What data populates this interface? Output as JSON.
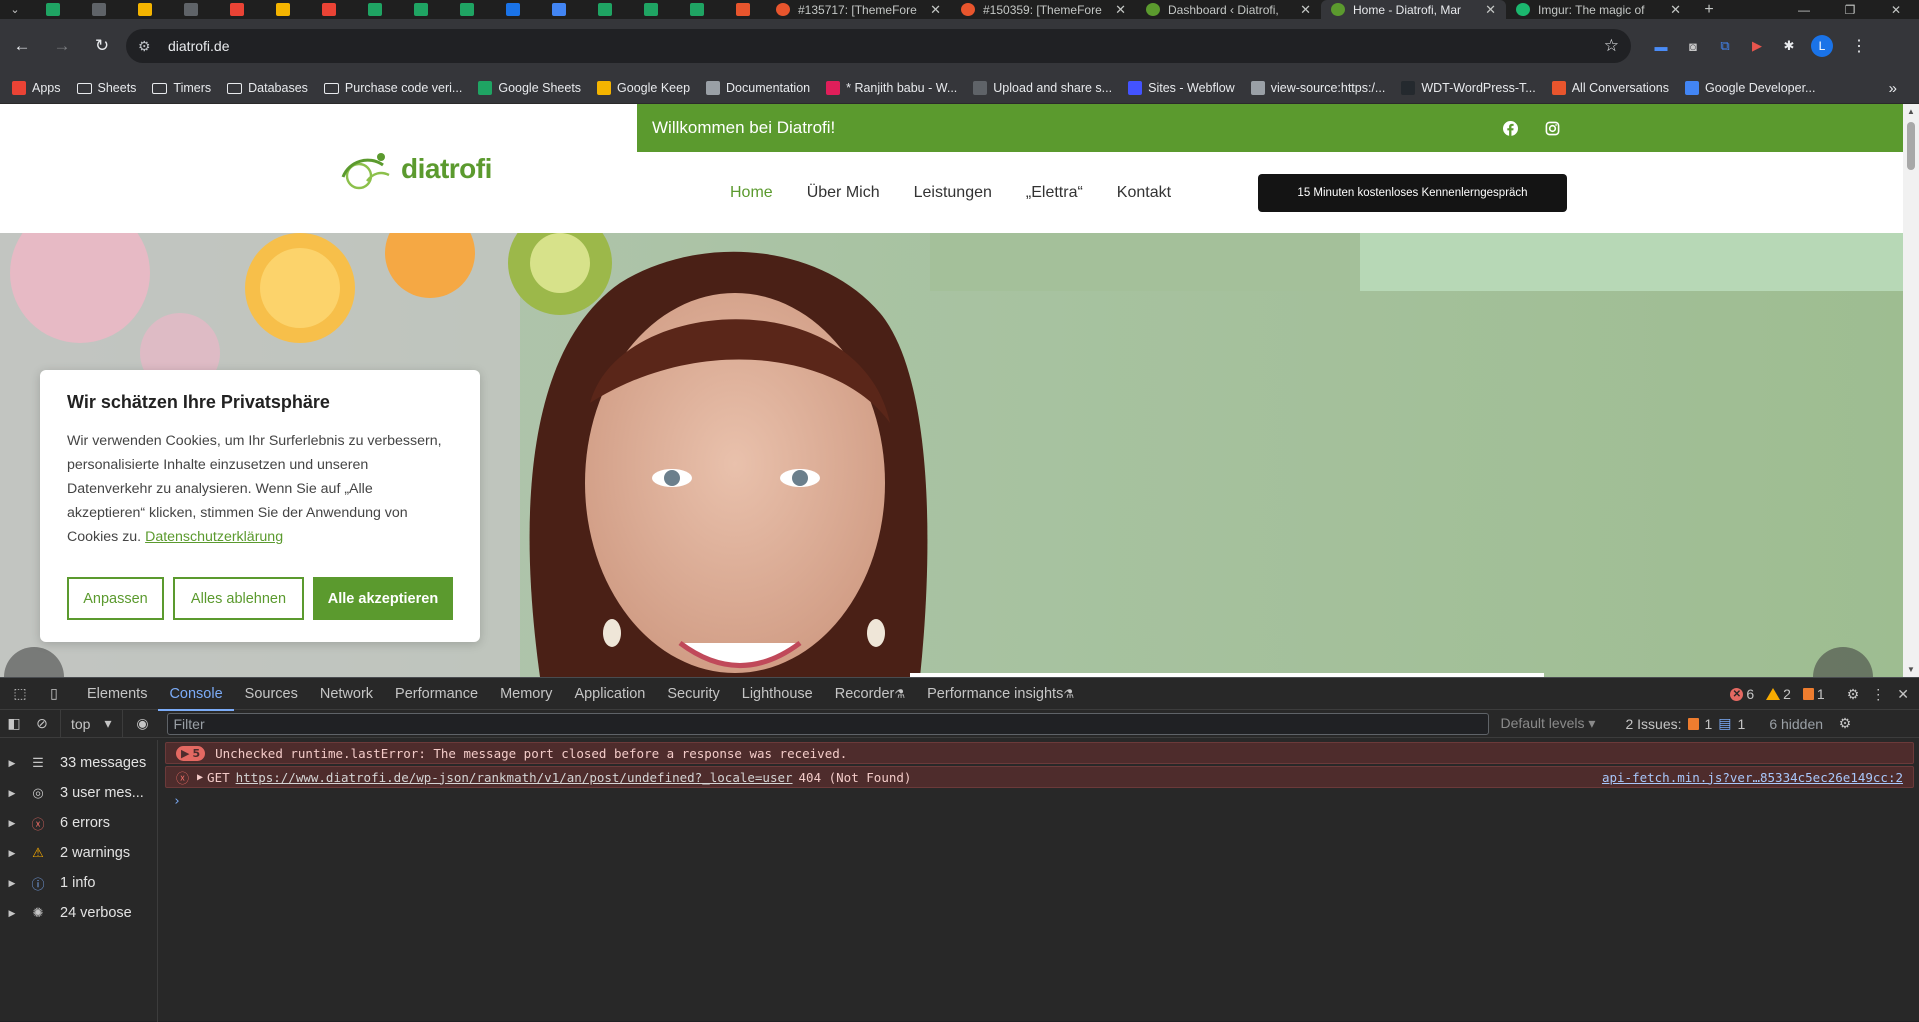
{
  "browser": {
    "tabs": [
      {
        "title": "#135717: [ThemeFore",
        "favicon_color": "#e8552d"
      },
      {
        "title": "#150359: [ThemeFore",
        "favicon_color": "#e8552d"
      },
      {
        "title": "Dashboard ‹ Diatrofi,",
        "favicon_color": "#5b9a2e"
      },
      {
        "title": "Home - Diatrofi, Mar",
        "favicon_color": "#5b9a2e",
        "active": true
      },
      {
        "title": "Imgur: The magic of",
        "favicon_color": "#1bb76e"
      }
    ],
    "pinned_tab_colors": [
      "#1fa463",
      "#5f6368",
      "#f4b400",
      "#5f6368",
      "#ea4335",
      "#f4b400",
      "#ea4335",
      "#1fa463",
      "#1fa463",
      "#1fa463",
      "#1a73e8",
      "#4285f4",
      "#1fa463",
      "#1fa463",
      "#1fa463",
      "#e8552d"
    ],
    "address": "diatrofi.de",
    "profile_initial": "L",
    "bookmarks": [
      {
        "label": "Apps",
        "icon": "apps-grid-icon",
        "color": "#ea4335"
      },
      {
        "label": "Sheets",
        "icon": "folder-icon"
      },
      {
        "label": "Timers",
        "icon": "folder-icon"
      },
      {
        "label": "Databases",
        "icon": "folder-icon"
      },
      {
        "label": "Purchase code veri...",
        "icon": "folder-icon"
      },
      {
        "label": "Google Sheets",
        "icon": "sheets-icon",
        "color": "#1fa463"
      },
      {
        "label": "Google Keep",
        "icon": "keep-icon",
        "color": "#f4b400"
      },
      {
        "label": "Documentation",
        "icon": "globe-icon",
        "color": "#9aa0a6"
      },
      {
        "label": "* Ranjith babu - W...",
        "icon": "slack-icon",
        "color": "#e01e5a"
      },
      {
        "label": "Upload and share s...",
        "icon": "sb-icon",
        "color": "#5f6368"
      },
      {
        "label": "Sites - Webflow",
        "icon": "webflow-icon",
        "color": "#4353ff"
      },
      {
        "label": "view-source:https:/...",
        "icon": "globe-icon",
        "color": "#9aa0a6"
      },
      {
        "label": "WDT-WordPress-T...",
        "icon": "github-icon",
        "color": "#24292e"
      },
      {
        "label": "All Conversations",
        "icon": "conversation-icon",
        "color": "#e8552d"
      },
      {
        "label": "Google Developer...",
        "icon": "google-icon",
        "color": "#4285f4"
      }
    ]
  },
  "site": {
    "logo_text": "diatrofi",
    "brand_color": "#5b9a2e",
    "topbar_text": "Willkommen bei Diatrofi!",
    "nav": [
      {
        "label": "Home",
        "active": true
      },
      {
        "label": "Über Mich"
      },
      {
        "label": "Leistungen"
      },
      {
        "label": "„Elettra“"
      },
      {
        "label": "Kontakt"
      }
    ],
    "cta_label": "15 Minuten kostenloses Kennenlerngespräch"
  },
  "cookie": {
    "title": "Wir schätzen Ihre Privatsphäre",
    "body": "Wir verwenden Cookies, um Ihr Surferlebnis zu verbessern, personalisierte Inhalte einzusetzen und unseren Datenverkehr zu analysieren. Wenn Sie auf „Alle akzeptieren“ klicken, stimmen Sie der Anwendung von Cookies zu.",
    "link": "Datenschutzerklärung",
    "buttons": {
      "customize": "Anpassen",
      "reject": "Alles ablehnen",
      "accept": "Alle akzeptieren"
    }
  },
  "devtools": {
    "tabs": [
      "Elements",
      "Console",
      "Sources",
      "Network",
      "Performance",
      "Memory",
      "Application",
      "Security",
      "Lighthouse",
      "Recorder",
      "Performance insights"
    ],
    "active_tab": "Console",
    "counts": {
      "errors": "6",
      "warnings": "2",
      "issues_badge": "1"
    },
    "context": "top",
    "filter_placeholder": "Filter",
    "levels": "Default levels",
    "issues_label": "2 Issues:",
    "issues_counts": {
      "warn": "1",
      "info": "1"
    },
    "hidden": "6 hidden",
    "sidebar": [
      {
        "label": "33 messages",
        "icon": "list-icon"
      },
      {
        "label": "3 user mes...",
        "icon": "user-icon"
      },
      {
        "label": "6 errors",
        "icon": "error-icon"
      },
      {
        "label": "2 warnings",
        "icon": "warning-icon"
      },
      {
        "label": "1 info",
        "icon": "info-icon"
      },
      {
        "label": "24 verbose",
        "icon": "bug-icon"
      }
    ],
    "messages": [
      {
        "count": "5",
        "text": "Unchecked runtime.lastError: The message port closed before a response was received."
      },
      {
        "method": "GET",
        "url": "https://www.diatrofi.de/wp-json/rankmath/v1/an/post/undefined?_locale=user",
        "status": "404 (Not Found)",
        "source": "api-fetch.min.js?ver…85334c5ec26e149cc:2"
      }
    ]
  }
}
